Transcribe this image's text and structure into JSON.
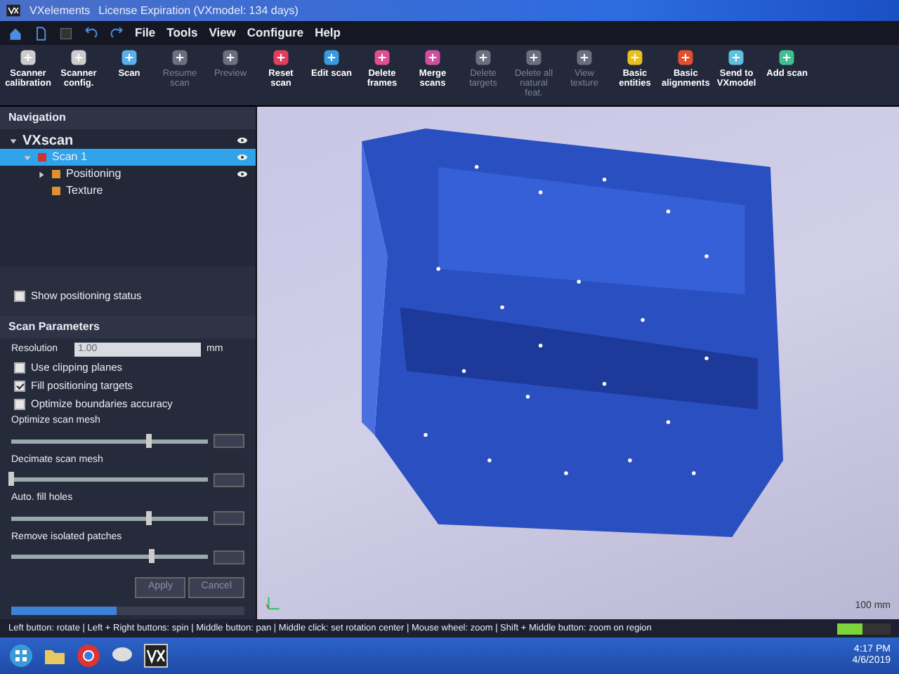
{
  "window": {
    "title": "VXelements",
    "title_suffix": "License Expiration (VXmodel: 134 days)"
  },
  "menu": [
    "File",
    "Tools",
    "View",
    "Configure",
    "Help"
  ],
  "toolbar": [
    {
      "label": "Scanner calibration",
      "disabled": false
    },
    {
      "label": "Scanner config.",
      "disabled": false
    },
    {
      "label": "Scan",
      "disabled": false
    },
    {
      "label": "Resume scan",
      "disabled": true
    },
    {
      "label": "Preview",
      "disabled": true
    },
    {
      "label": "Reset scan",
      "disabled": false
    },
    {
      "label": "Edit scan",
      "disabled": false
    },
    {
      "label": "Delete frames",
      "disabled": false
    },
    {
      "label": "Merge scans",
      "disabled": false
    },
    {
      "label": "Delete targets",
      "disabled": true
    },
    {
      "label": "Delete all natural feat.",
      "disabled": true
    },
    {
      "label": "View texture",
      "disabled": true
    },
    {
      "label": "Basic entities",
      "disabled": false
    },
    {
      "label": "Basic alignments",
      "disabled": false
    },
    {
      "label": "Send to VXmodel",
      "disabled": false
    },
    {
      "label": "Add scan",
      "disabled": false
    }
  ],
  "navigation": {
    "title": "Navigation",
    "tree": [
      {
        "label": "VXscan",
        "expanded": true,
        "selected": false,
        "children": [
          {
            "label": "Scan 1",
            "expanded": true,
            "selected": true,
            "children": [
              {
                "label": "Positioning",
                "expanded": false,
                "selected": false
              },
              {
                "label": "Texture",
                "selected": false
              }
            ]
          }
        ]
      }
    ]
  },
  "options": [
    {
      "label": "Show positioning status",
      "checked": false
    }
  ],
  "scan_parameters": {
    "title": "Scan Parameters",
    "resolution": {
      "label": "Resolution",
      "value": "1.00",
      "unit": "mm"
    },
    "checks": [
      {
        "label": "Use clipping planes",
        "checked": false
      },
      {
        "label": "Fill positioning targets",
        "checked": true
      },
      {
        "label": "Optimize boundaries accuracy",
        "checked": false
      }
    ],
    "sliders": [
      {
        "label": "Optimize scan mesh",
        "level": 0.7
      },
      {
        "label": "Decimate scan mesh",
        "level": 0.0
      },
      {
        "label": "Auto. fill holes",
        "level": 0.7
      },
      {
        "label": "Remove isolated patches",
        "level": 0.72
      }
    ],
    "buttons": [
      {
        "label": "Apply",
        "disabled": true
      },
      {
        "label": "Cancel",
        "disabled": true
      }
    ]
  },
  "progress": {
    "level": 0.45
  },
  "viewport": {
    "scale_label": "100 mm"
  },
  "status_bar": {
    "hint": "Left button: rotate | Left + Right buttons: spin | Middle button: pan | Middle click: set rotation center | Mouse wheel: zoom | Shift + Middle button: zoom on region",
    "memory": {
      "level": 0.48
    }
  },
  "taskbar": {
    "time": "4:17 PM",
    "date": "4/6/2019"
  }
}
